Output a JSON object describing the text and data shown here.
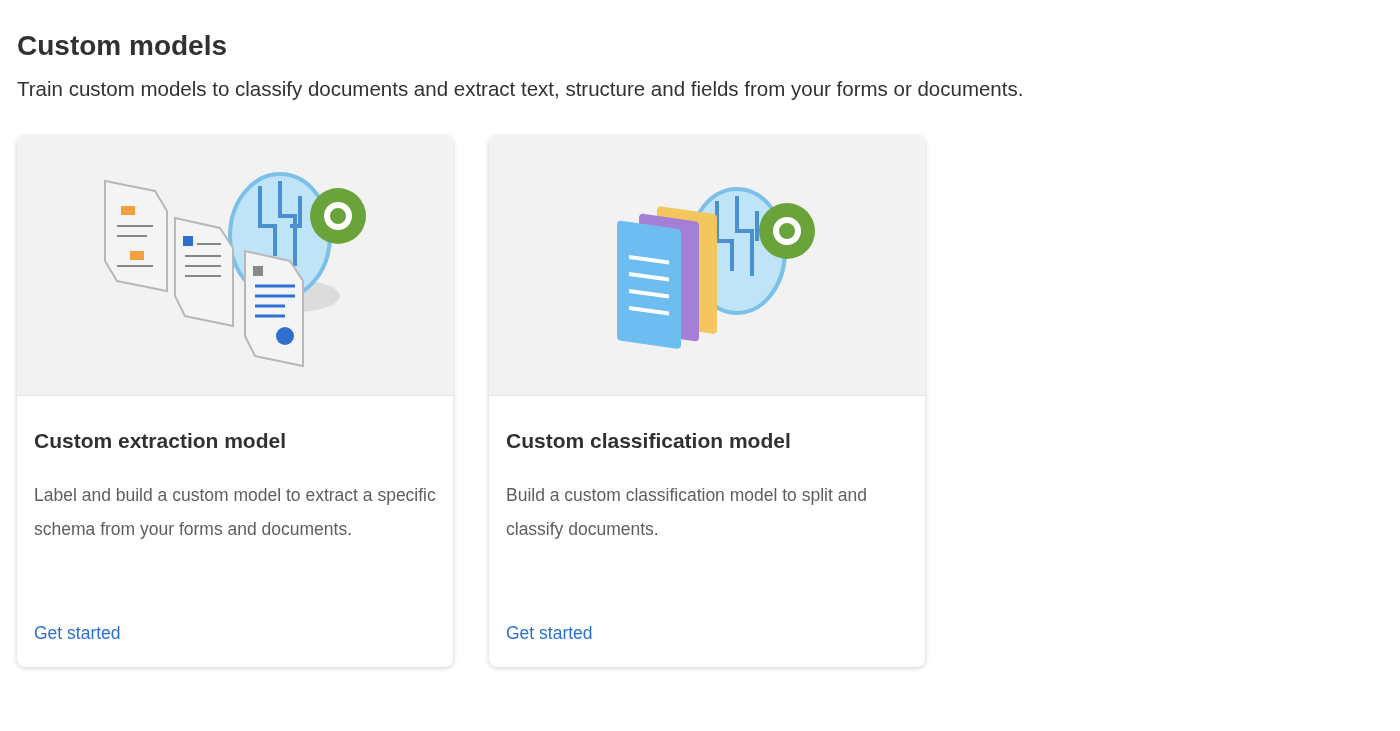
{
  "page": {
    "title": "Custom models",
    "description": "Train custom models to classify documents and extract text, structure and fields from your forms or documents."
  },
  "cards": [
    {
      "kind": "extraction",
      "title": "Custom extraction model",
      "description": "Label and build a custom model to extract a specific schema from your forms and documents.",
      "link": "Get started"
    },
    {
      "kind": "classification",
      "title": "Custom classification model",
      "description": "Build a custom classification model to split and classify documents.",
      "link": "Get started"
    }
  ]
}
